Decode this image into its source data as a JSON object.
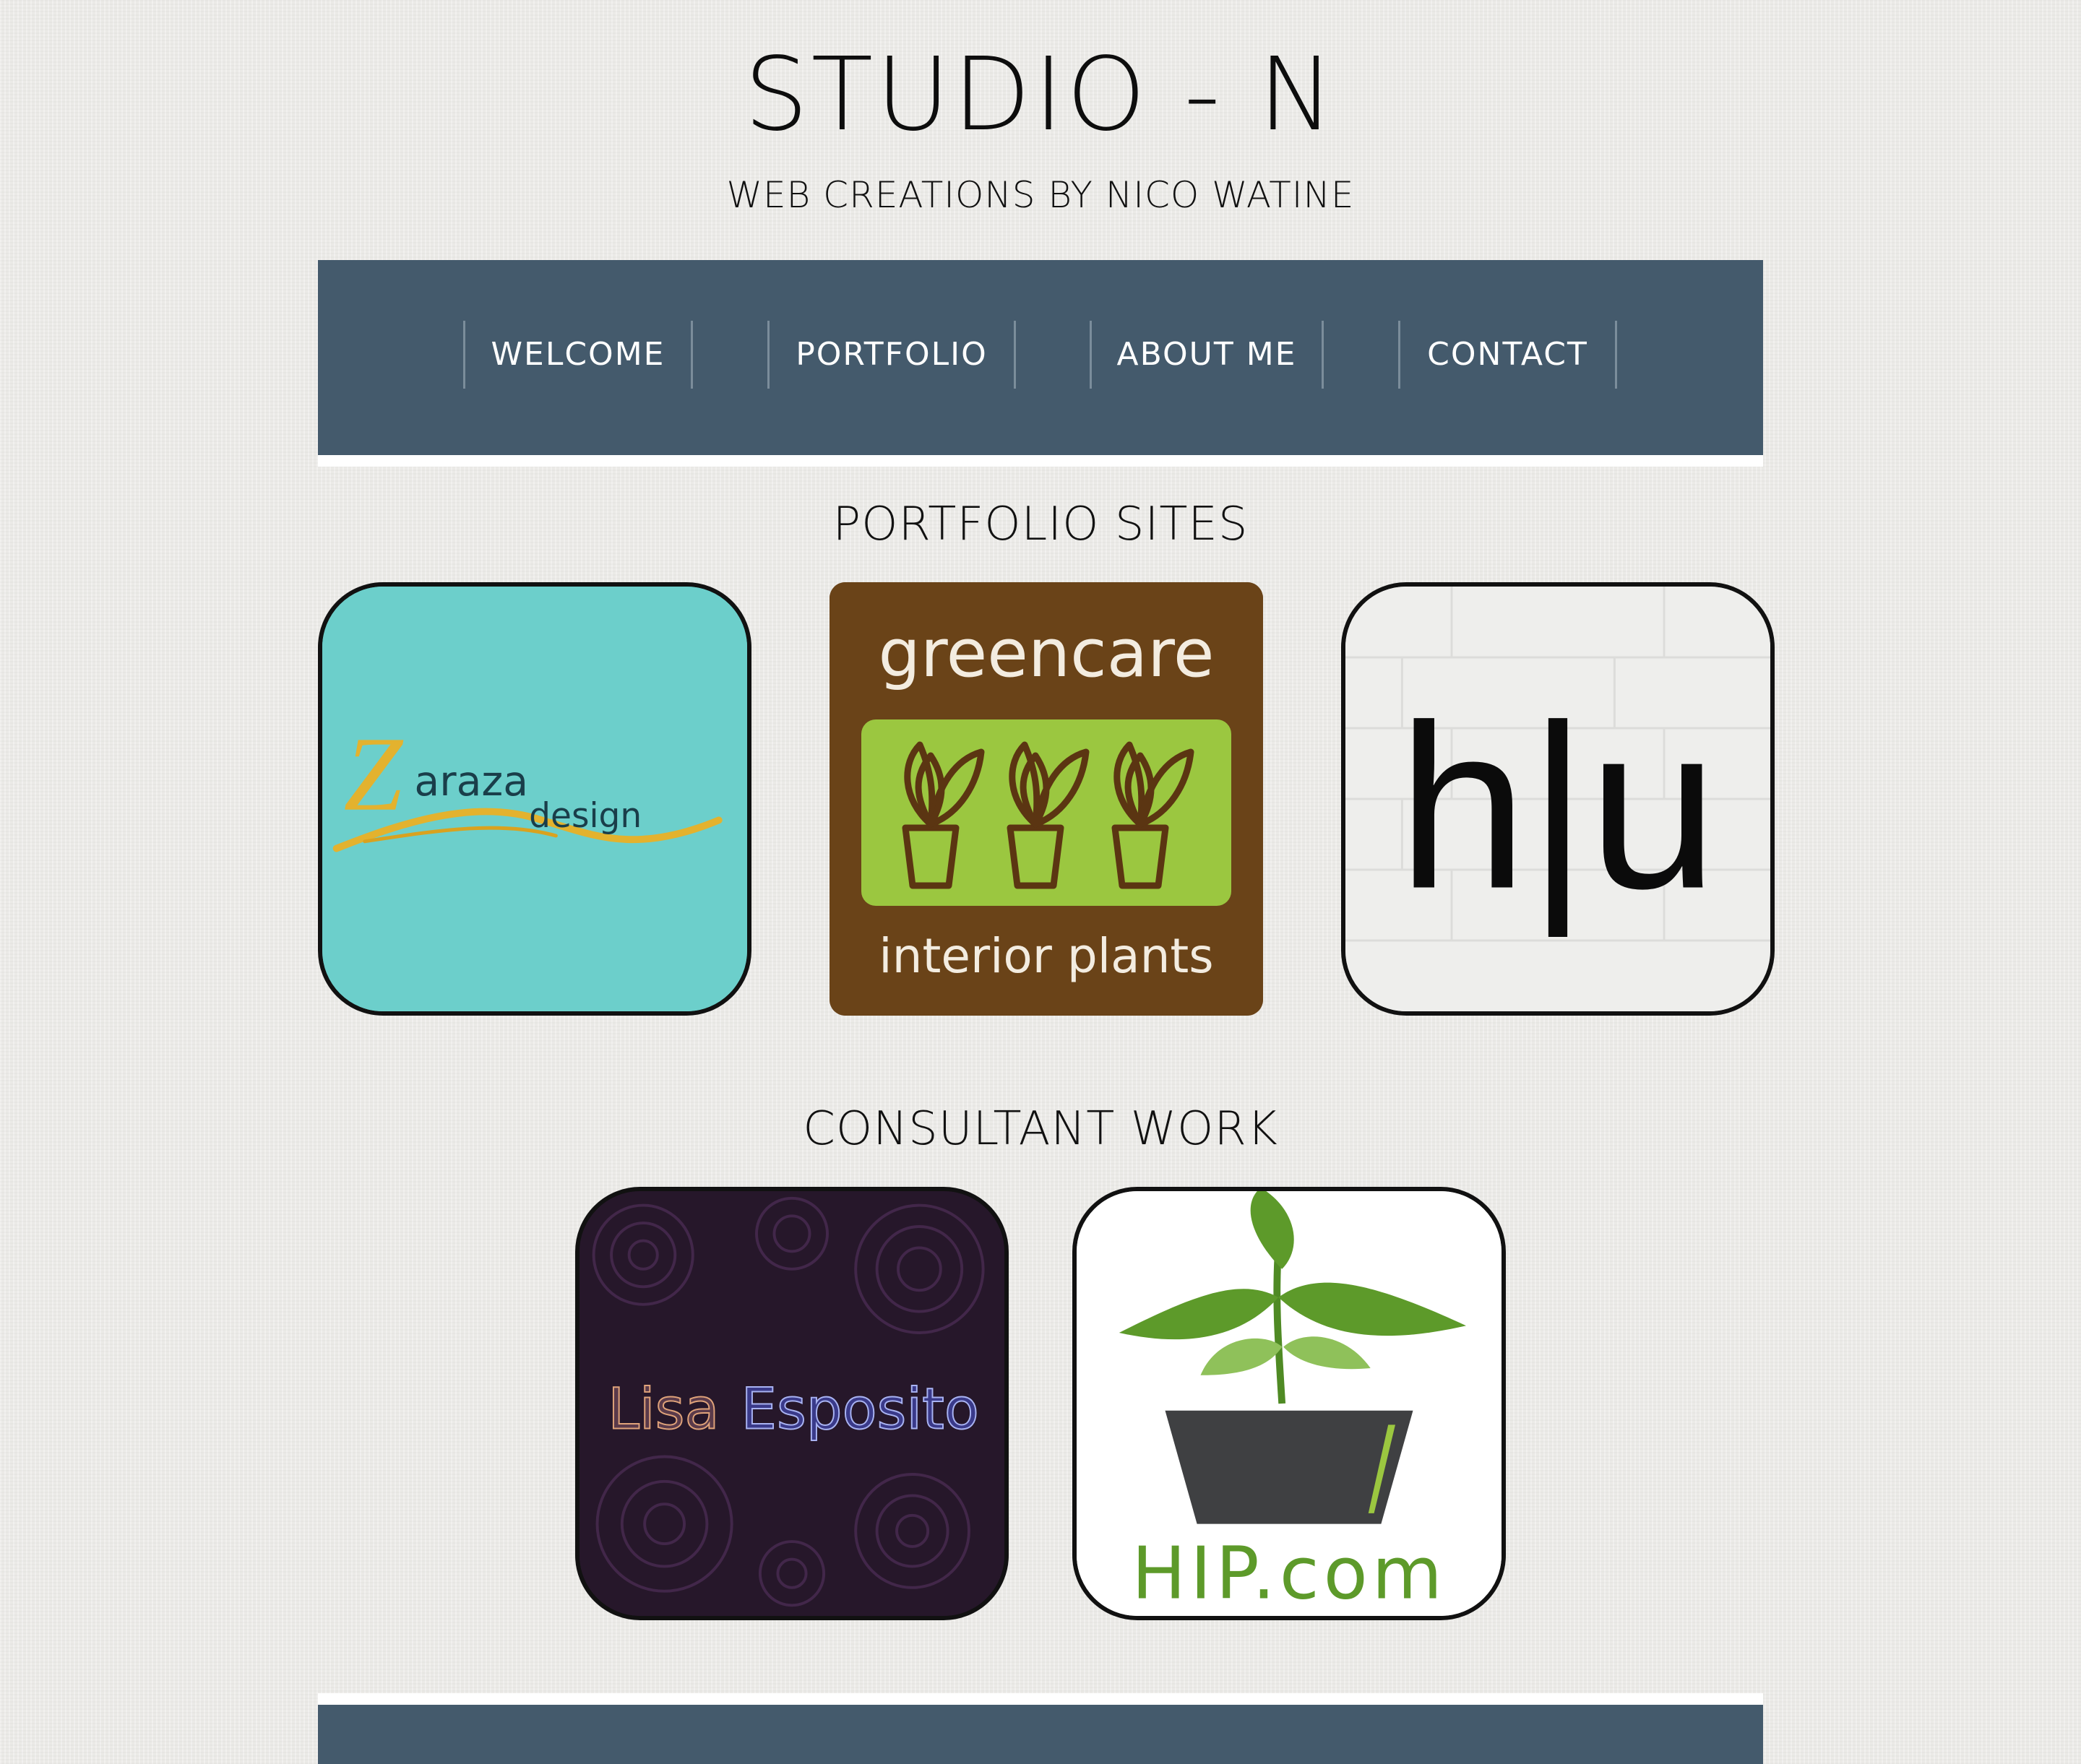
{
  "site": {
    "title": "STUDIO - N",
    "subtitle": "WEB CREATIONS BY NICO WATINE"
  },
  "nav": {
    "items": [
      {
        "label": "WELCOME"
      },
      {
        "label": "PORTFOLIO"
      },
      {
        "label": "ABOUT ME"
      },
      {
        "label": "CONTACT"
      }
    ]
  },
  "portfolio": {
    "heading": "PORTFOLIO SITES",
    "tiles": [
      {
        "name": "Zaraza design",
        "logo_text_1": "araza",
        "logo_text_2": "design",
        "logo_initial": "Z",
        "background": "#6ccfcb",
        "accent": "#e3b22e"
      },
      {
        "name": "greencare interior plants",
        "logo_text_1": "greencare",
        "logo_text_2": "interior plants",
        "background": "#6a4318",
        "accent": "#9bc740"
      },
      {
        "name": "h|u",
        "logo_text_1": "h|u",
        "background": "#eeeeec"
      }
    ]
  },
  "consultant": {
    "heading": "CONSULTANT WORK",
    "tiles": [
      {
        "name": "Lisa Esposito",
        "logo_text_1": "Lisa",
        "logo_text_2": "Esposito",
        "background": "#2a1a2e"
      },
      {
        "name": "HIP.com",
        "logo_text_1": "HIP.com",
        "background": "#ffffff",
        "accent": "#5d9a2a"
      }
    ]
  },
  "colors": {
    "nav_background": "#445a6c",
    "page_background": "#ebeae7"
  }
}
